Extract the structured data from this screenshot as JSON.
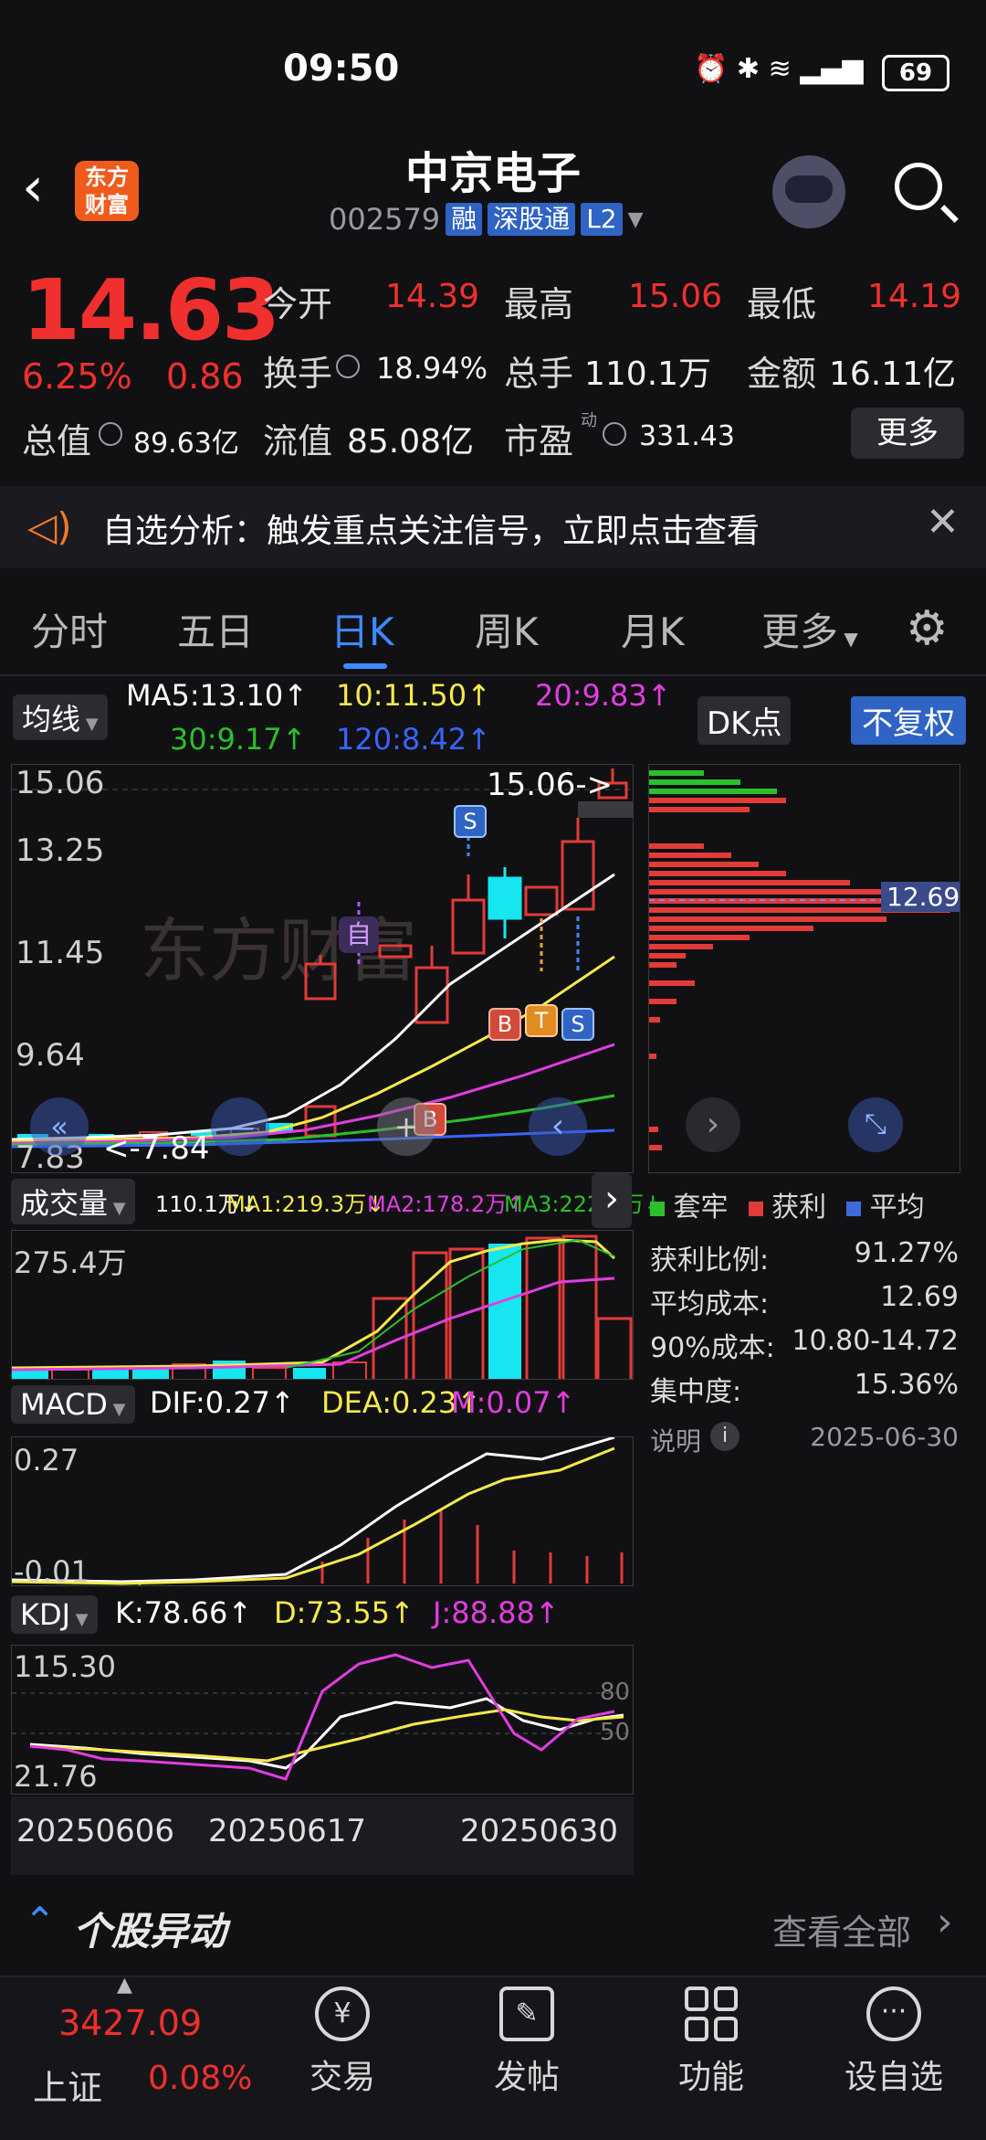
{
  "status_bar": {
    "time": "09:50",
    "battery": "69"
  },
  "header": {
    "title": "中京电子",
    "code": "002579",
    "tags": [
      "融",
      "深股通",
      "L2"
    ],
    "logo_text": "东方财富"
  },
  "quote": {
    "price": "14.63",
    "change_pct": "6.25%",
    "change_amt": "0.86",
    "open_label": "今开",
    "open": "14.39",
    "high_label": "最高",
    "high": "15.06",
    "low_label": "最低",
    "low": "14.19",
    "turnover_label": "换手",
    "turnover": "18.94%",
    "volume_label": "总手",
    "volume": "110.1万",
    "amount_label": "金额",
    "amount": "16.11亿",
    "mktcap_label": "总值",
    "mktcap": "89.63亿",
    "float_label": "流值",
    "float_cap": "85.08亿",
    "pe_label": "市盈",
    "pe_sup": "动",
    "pe": "331.43",
    "more_label": "更多"
  },
  "alert": {
    "text": "自选分析：触发重点关注信号，立即点击查看"
  },
  "tabs": [
    {
      "label": "分时"
    },
    {
      "label": "五日"
    },
    {
      "label": "日K",
      "active": true
    },
    {
      "label": "周K"
    },
    {
      "label": "月K"
    },
    {
      "label": "更多"
    }
  ],
  "kline": {
    "ma_pill": "均线",
    "ma5": "MA5:13.10↑",
    "ma10": "10:11.50↑",
    "ma20": "20:9.83↑",
    "ma30": "30:9.17↑",
    "ma120": "120:8.42↑",
    "dk_btn": "DK点",
    "adjust_btn": "不复权",
    "y_labels": [
      "15.06",
      "13.25",
      "11.45",
      "9.64",
      "7.83"
    ],
    "high_marker": "15.06->",
    "low_marker": "<-7.84",
    "markers": [
      "S",
      "自",
      "B",
      "T",
      "S",
      "B"
    ],
    "watermark": "东方财富",
    "colors": {
      "ma5": "#ffffff",
      "ma10": "#f5e94a",
      "ma20": "#e23de0",
      "ma30": "#2bbf2b",
      "ma120": "#3b64ff"
    }
  },
  "chip": {
    "avg_label": "12.69",
    "legend": [
      "套牢",
      "获利",
      "平均"
    ],
    "rows": [
      {
        "label": "获利比例:",
        "value": "91.27%"
      },
      {
        "label": "平均成本:",
        "value": "12.69"
      },
      {
        "label": "90%成本:",
        "value": "10.80-14.72"
      },
      {
        "label": "集中度:",
        "value": "15.36%"
      }
    ],
    "note_label": "说明",
    "date": "2025-06-30"
  },
  "volume": {
    "pill": "成交量",
    "total": "110.1万↓",
    "ma1": "MA1:219.3万↓",
    "ma2": "MA2:178.2万↑",
    "ma3": "MA3:222.9万↓",
    "y_label": "275.4万"
  },
  "macd": {
    "pill": "MACD",
    "dif": "DIF:0.27↑",
    "dea": "DEA:0.23↑",
    "m": "M:0.07↑",
    "y_top": "0.27",
    "y_bottom": "-0.01"
  },
  "kdj": {
    "pill": "KDJ",
    "k": "K:78.66↑",
    "d": "D:73.55↑",
    "j": "J:88.88↑",
    "y_top": "115.30",
    "y_bottom": "21.76",
    "ref_80": "80",
    "ref_50": "50"
  },
  "dates": [
    "20250606",
    "20250617",
    "20250630"
  ],
  "movement": {
    "title": "个股异动",
    "view_all": "查看全部"
  },
  "footer": {
    "index_value": "3427.09",
    "index_name": "上证",
    "index_change": "0.08%",
    "items": [
      {
        "label": "交易"
      },
      {
        "label": "发帖"
      },
      {
        "label": "功能"
      },
      {
        "label": "设自选"
      }
    ]
  }
}
